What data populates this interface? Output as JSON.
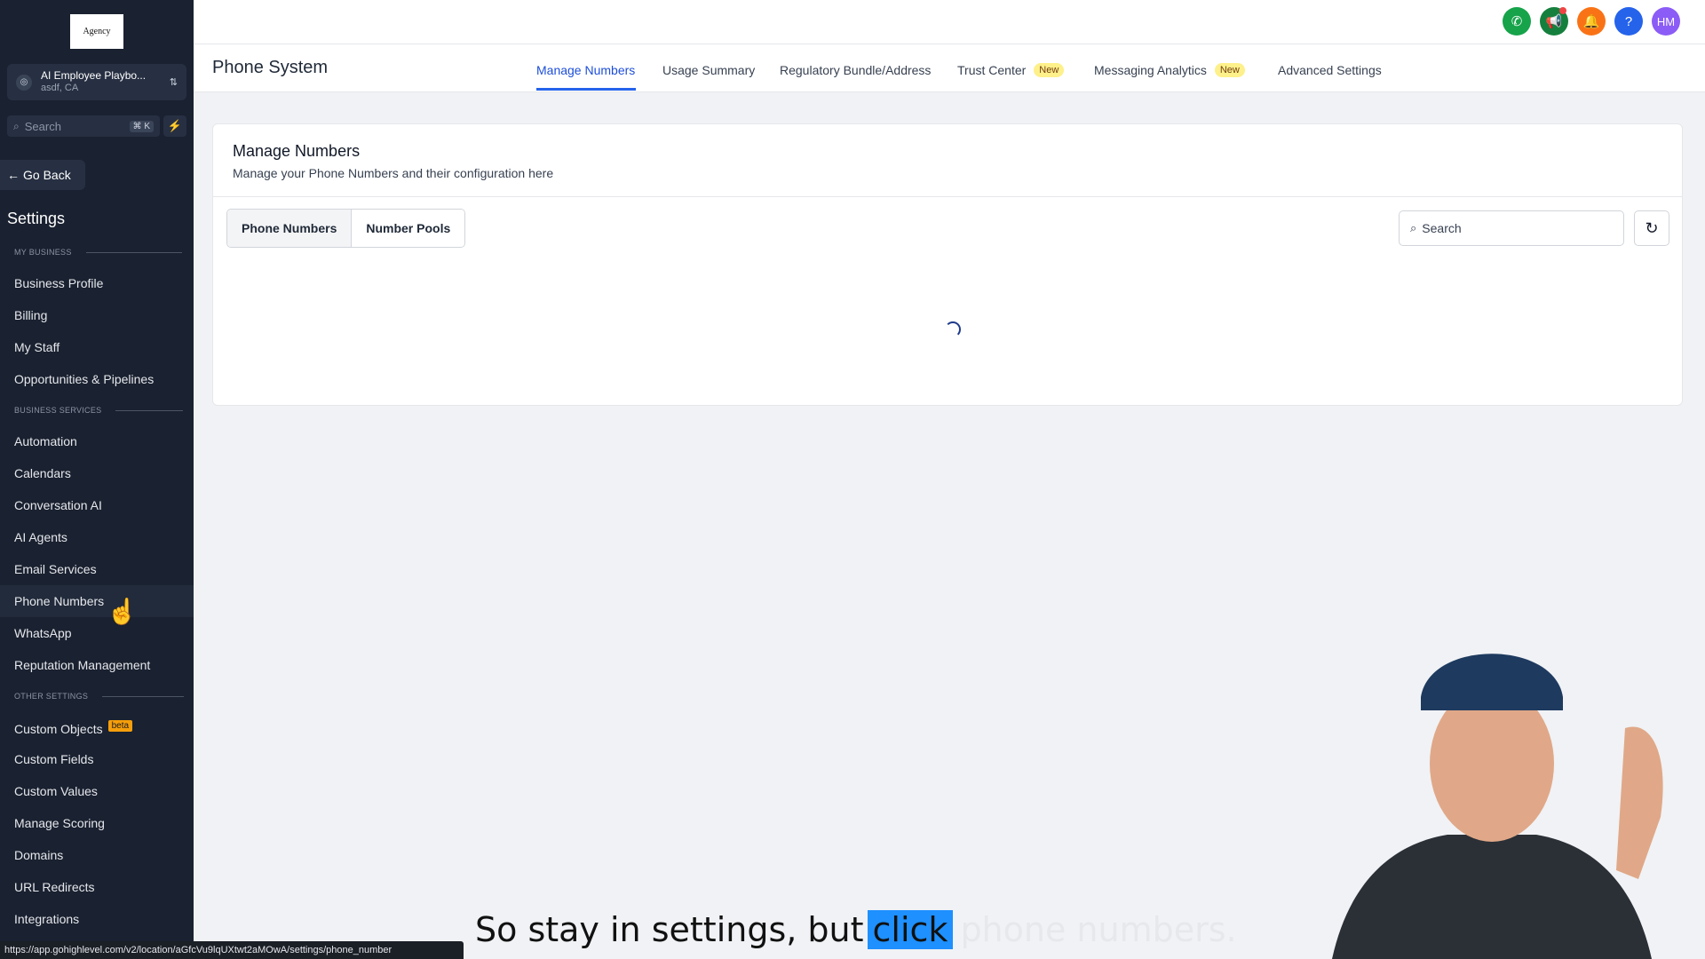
{
  "sidebar": {
    "logo_text": "Agency",
    "account": {
      "name": "AI Employee Playbo...",
      "location": "asdf, CA"
    },
    "search": {
      "label": "Search",
      "shortcut": "⌘ K"
    },
    "go_back": "Go Back",
    "title": "Settings",
    "sections": {
      "my_business": "MY BUSINESS",
      "business_services": "BUSINESS SERVICES",
      "other_settings": "OTHER SETTINGS"
    },
    "items": {
      "business_profile": "Business Profile",
      "billing": "Billing",
      "my_staff": "My Staff",
      "opportunities": "Opportunities & Pipelines",
      "automation": "Automation",
      "calendars": "Calendars",
      "conversation_ai": "Conversation AI",
      "ai_agents": "AI Agents",
      "email_services": "Email Services",
      "phone_numbers": "Phone Numbers",
      "whatsapp": "WhatsApp",
      "reputation": "Reputation Management",
      "custom_objects": "Custom Objects",
      "custom_objects_badge": "beta",
      "custom_fields": "Custom Fields",
      "custom_values": "Custom Values",
      "manage_scoring": "Manage Scoring",
      "domains": "Domains",
      "url_redirects": "URL Redirects",
      "integrations": "Integrations"
    }
  },
  "status_url": "https://app.gohighlevel.com/v2/location/aGfcVu9lqUXtwt2aMOwA/settings/phone_number",
  "topbar": {
    "avatar_initials": "HM",
    "icons": [
      "phone-icon",
      "megaphone-icon",
      "bell-icon",
      "help-icon",
      "avatar"
    ],
    "colors": {
      "phone": "#16a34a",
      "megaphone": "#15803d",
      "bell": "#f97316",
      "help": "#2563eb",
      "avatar": "#8b5cf6"
    }
  },
  "tabs": {
    "system_title": "Phone System",
    "manage_numbers": "Manage Numbers",
    "usage_summary": "Usage Summary",
    "regulatory": "Regulatory Bundle/Address",
    "trust_center": "Trust Center",
    "messaging_analytics": "Messaging Analytics",
    "advanced_settings": "Advanced Settings",
    "new_badge": "New"
  },
  "card": {
    "title": "Manage Numbers",
    "subtitle": "Manage your Phone Numbers and their configuration here",
    "segments": {
      "phone_numbers": "Phone Numbers",
      "number_pools": "Number Pools"
    },
    "search_label": "Search"
  },
  "caption": {
    "before": "So stay in settings, but",
    "highlight": "click",
    "after": "phone numbers."
  }
}
